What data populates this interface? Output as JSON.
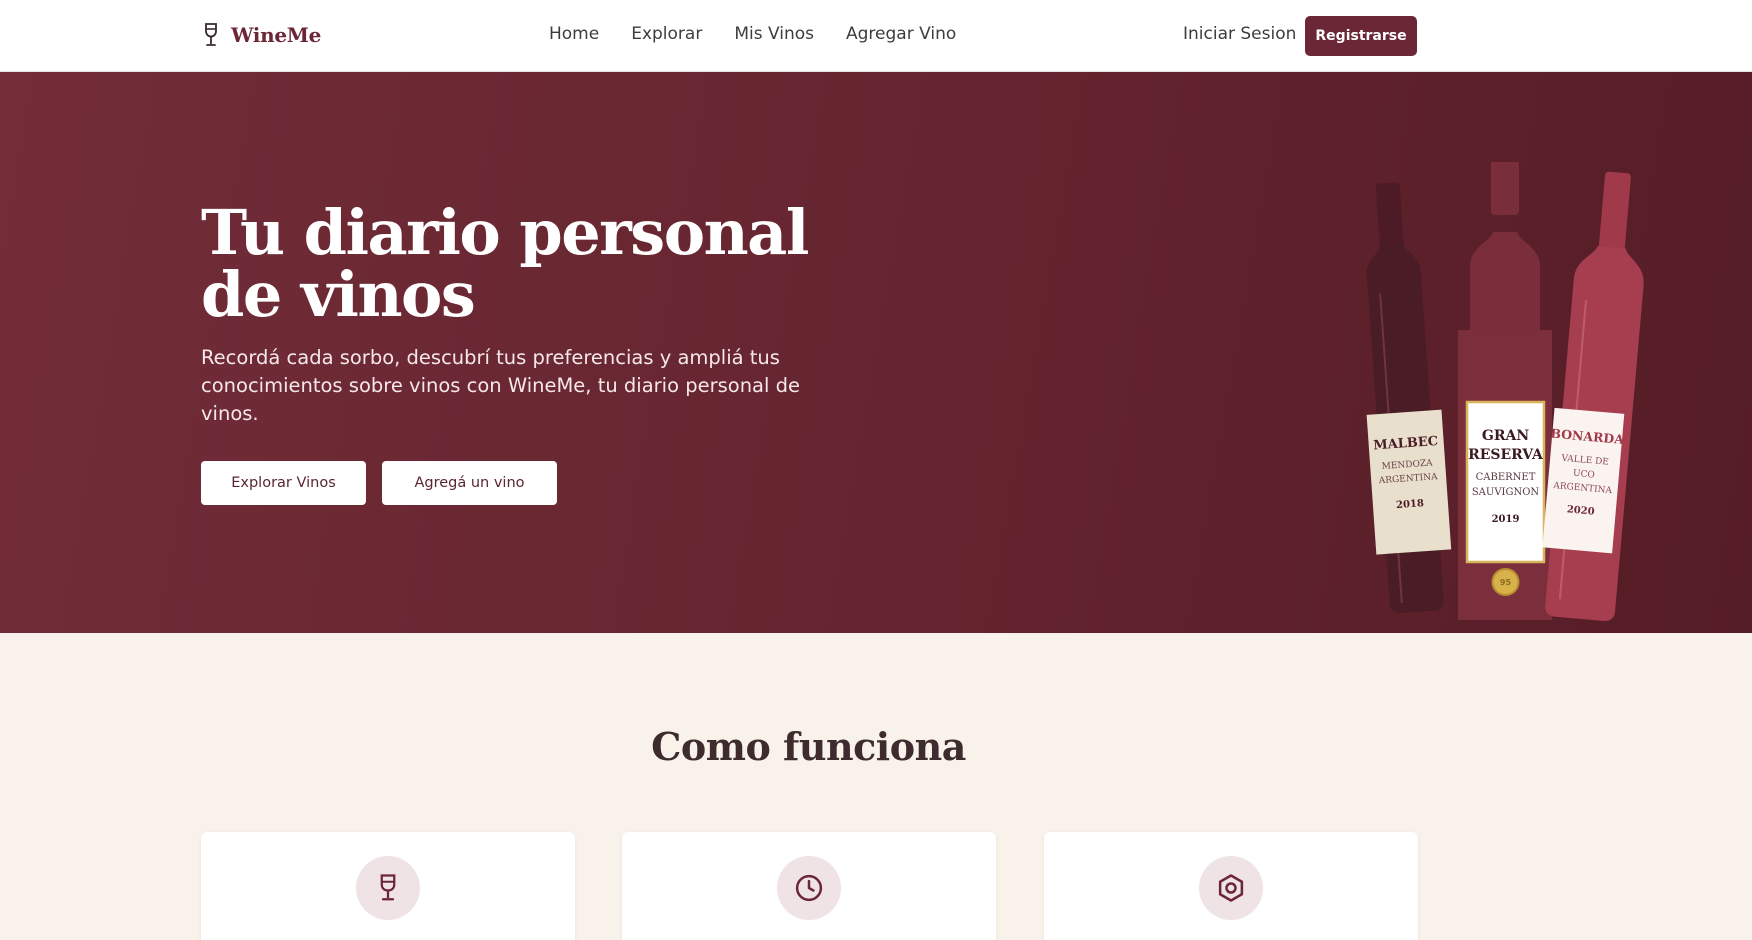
{
  "brand": {
    "name": "WineMe",
    "icon": "wine-glass-icon",
    "color": "#6b2735"
  },
  "nav": {
    "links": [
      "Home",
      "Explorar",
      "Mis Vinos",
      "Agregar Vino"
    ],
    "login": "Iniciar Sesion",
    "register": "Registrarse"
  },
  "hero": {
    "title": "Tu diario personal de vinos",
    "subtitle": "Recordá cada sorbo, descubrí tus preferencias y ampliá tus conocimientos sobre vinos con WineMe, tu diario personal de vinos.",
    "btn_explore": "Explorar Vinos",
    "btn_add": "Agregá un vino",
    "background": "#6b2735",
    "bottles": [
      {
        "name": "MALBEC",
        "region_1": "MENDOZA",
        "region_2": "ARGENTINA",
        "year": "2018"
      },
      {
        "name_1": "GRAN",
        "name_2": "RESERVA",
        "grape_1": "CABERNET",
        "grape_2": "SAUVIGNON",
        "year": "2019",
        "badge": "95"
      },
      {
        "name": "BONARDA",
        "region_1": "VALLE DE",
        "region_2": "UCO",
        "region_3": "ARGENTINA",
        "year": "2020"
      }
    ]
  },
  "how": {
    "title": "Como funciona",
    "cards": [
      {
        "icon": "wine-glass-icon"
      },
      {
        "icon": "clock-icon"
      },
      {
        "icon": "hexagon-icon"
      }
    ]
  }
}
